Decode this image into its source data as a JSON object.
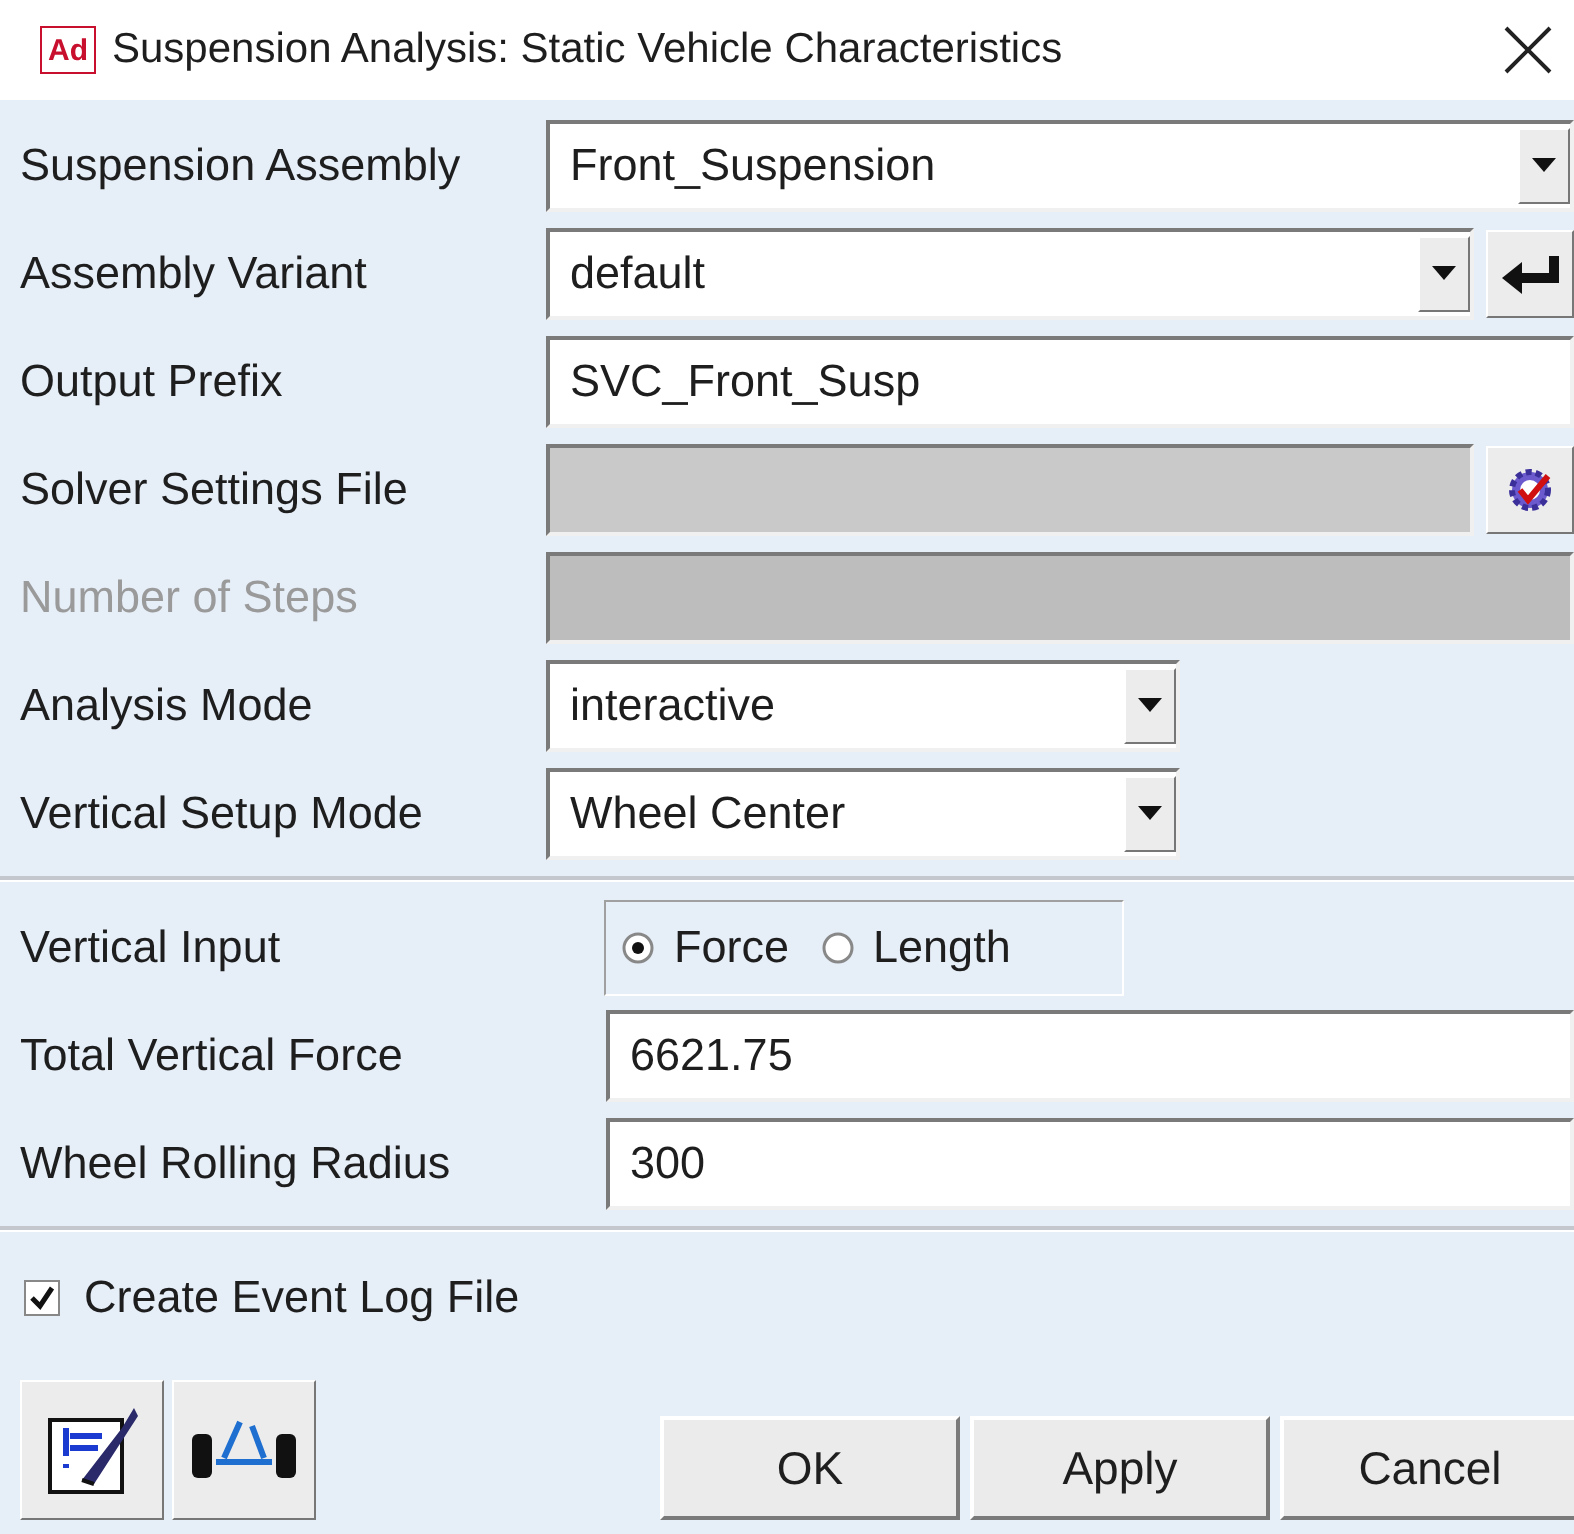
{
  "window": {
    "title": "Suspension Analysis: Static Vehicle Characteristics",
    "app_badge": "Ad"
  },
  "rows": [
    {
      "label": "Suspension Assembly",
      "kind": "combo",
      "value": "Front_Suspension",
      "disabled": false
    },
    {
      "label": "Assembly Variant",
      "kind": "combo-enter",
      "value": "default",
      "disabled": false
    },
    {
      "label": "Output Prefix",
      "kind": "text",
      "value": "SVC_Front_Susp",
      "disabled": false
    },
    {
      "label": "Solver Settings File",
      "kind": "file",
      "disabled": false
    },
    {
      "label": "Number of Steps",
      "kind": "text",
      "disabled": true
    },
    {
      "label": "Analysis Mode",
      "kind": "short-combo",
      "value": "interactive",
      "disabled": false
    },
    {
      "label": "Vertical Setup Mode",
      "kind": "short-combo",
      "value": "Wheel Center",
      "disabled": false
    }
  ],
  "vertical": [
    {
      "label": "Vertical Input",
      "kind": "radio",
      "options": [
        {
          "label": "Force",
          "selected": true
        },
        {
          "label": "Length",
          "selected": false
        }
      ]
    },
    {
      "label": "Total Vertical Force",
      "kind": "text",
      "value": "6621.75"
    },
    {
      "label": "Wheel Rolling Radius",
      "kind": "text",
      "value": "300"
    }
  ],
  "event_log": {
    "label": "Create Event Log File",
    "checked": true
  },
  "buttons": [
    "OK",
    "Apply",
    "Cancel"
  ]
}
